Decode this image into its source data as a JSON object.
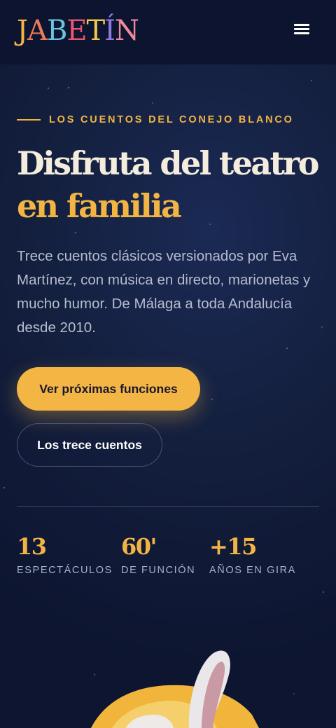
{
  "brand": {
    "logo_text": "JABETÍN",
    "logo_letters": [
      {
        "char": "J",
        "color": "#f2b544"
      },
      {
        "char": "A",
        "color": "#e97a5a"
      },
      {
        "char": "B",
        "color": "#6cc4dc"
      },
      {
        "char": "E",
        "color": "#e9566f"
      },
      {
        "char": "T",
        "color": "#f2c94c"
      },
      {
        "char": "Í",
        "color": "#8d7be0"
      },
      {
        "char": "N",
        "color": "#f08a9a"
      }
    ]
  },
  "header": {
    "menu_icon": "hamburger-menu-icon"
  },
  "hero": {
    "eyebrow": "LOS CUENTOS DEL CONEJO BLANCO",
    "title_line1": "Disfruta del teatro",
    "title_line2": "en familia",
    "description": "Trece cuentos clásicos versionados por Eva Martínez, con música en directo, marionetas y mucho humor. De Málaga a toda Andalucía desde 2010.",
    "primary_button": "Ver próximas funciones",
    "secondary_button": "Los trece cuentos"
  },
  "stats": [
    {
      "value": "13",
      "label": "ESPECTÁCULOS"
    },
    {
      "value": "60'",
      "label": "DE FUNCIÓN"
    },
    {
      "value": "+15",
      "label": "AÑOS EN GIRA"
    }
  ],
  "colors": {
    "accent": "#f2b544",
    "background": "#0d1530",
    "heading": "#f4ecdc",
    "body_text": "#b6bccd"
  }
}
